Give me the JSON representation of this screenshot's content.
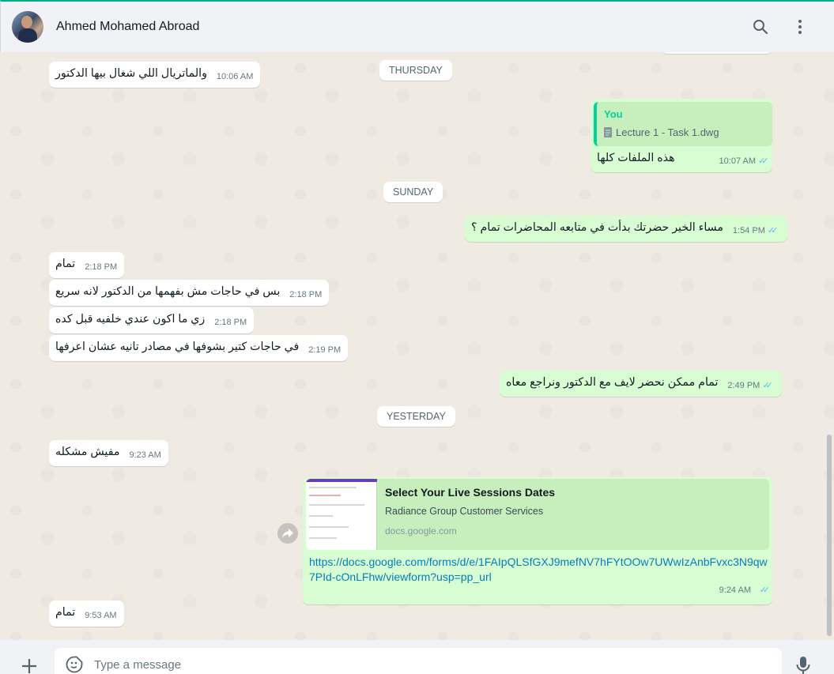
{
  "header": {
    "contact_name": "Ahmed Mohamed Abroad"
  },
  "date_chips": {
    "thursday": "THURSDAY",
    "sunday": "SUNDAY",
    "yesterday": "YESTERDAY"
  },
  "messages": [
    {
      "text": "والماتريال اللي شغال بيها الدكتور",
      "time": "10:06 AM",
      "direction": "incoming"
    },
    {
      "text": "هذه الملفات كلها",
      "time": "10:07 AM",
      "direction": "outgoing",
      "quote": {
        "author": "You",
        "file": "Lecture 1 - Task 1.dwg"
      }
    },
    {
      "text": "مساء الخير حضرتك بدأت في متابعه المحاضرات تمام ؟",
      "time": "1:54 PM",
      "direction": "outgoing"
    },
    {
      "text": "تمام",
      "time": "2:18 PM",
      "direction": "incoming"
    },
    {
      "text": "بس في حاجات مش بفهمها من الدكتور لانه سريع",
      "time": "2:18 PM",
      "direction": "incoming"
    },
    {
      "text": "زي ما اكون عندي خلفيه قبل كده",
      "time": "2:18 PM",
      "direction": "incoming"
    },
    {
      "text": "في حاجات كتير بشوفها في مصادر تانيه عشان اعرفها",
      "time": "2:19 PM",
      "direction": "incoming"
    },
    {
      "text": "تمام ممكن نحضر لايف مع الدكتور ونراجع معاه",
      "time": "2:49 PM",
      "direction": "outgoing"
    },
    {
      "text": "مفيش مشكله",
      "time": "9:23 AM",
      "direction": "incoming"
    },
    {
      "text": "https://docs.google.com/forms/d/e/1FAIpQLSfGXJ9mefNV7hFYtOOw7UWwIzAnbFvxc3N9qw7PId-cOnLFhw/viewform?usp=pp_url",
      "time": "9:24 AM",
      "direction": "outgoing",
      "preview": {
        "title": "Select Your Live Sessions Dates",
        "description": "Radiance Group Customer Services",
        "domain": "docs.google.com"
      }
    },
    {
      "text": "تمام",
      "time": "9:53 AM",
      "direction": "incoming"
    }
  ],
  "composer": {
    "placeholder": "Type a message"
  },
  "icons": {
    "search": "search-icon",
    "menu": "menu-dots-icon",
    "document": "document-icon",
    "read_receipt": "double-check-icon",
    "forward": "forward-icon",
    "attach": "plus-icon",
    "sticker": "sticker-icon",
    "mic": "microphone-icon"
  },
  "colors": {
    "accent": "#00a884",
    "outgoing_bubble": "#d9fdd3",
    "incoming_bubble": "#ffffff",
    "read_tick": "#53bdeb",
    "link": "#027eb5"
  }
}
